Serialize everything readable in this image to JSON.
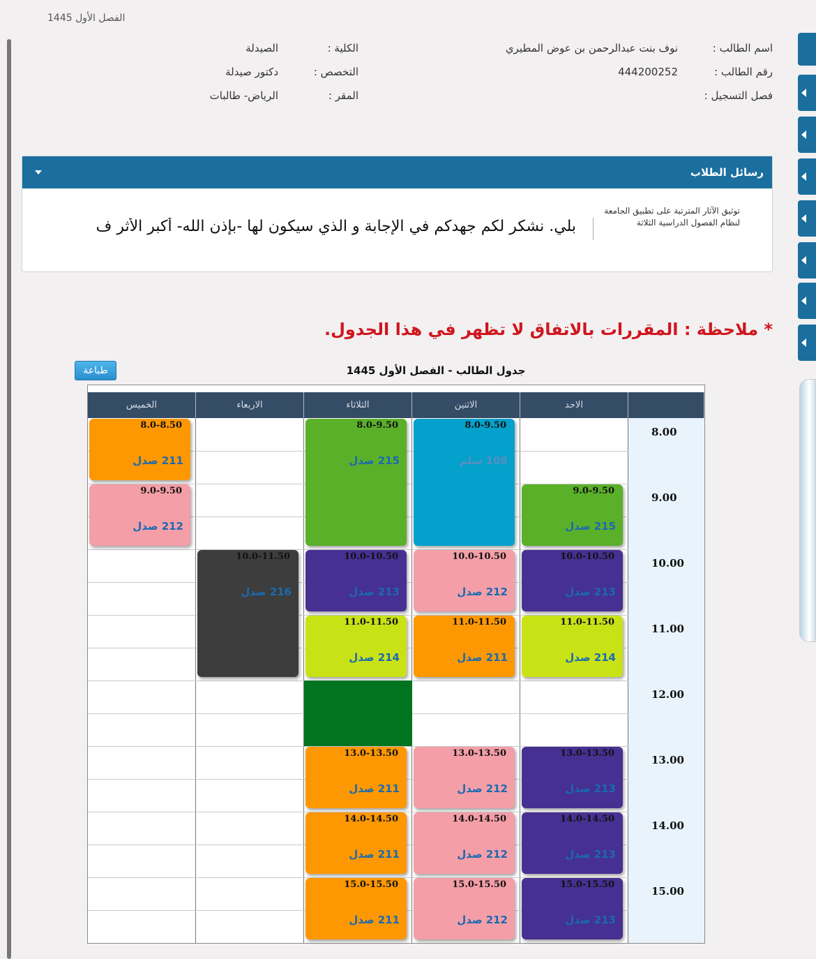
{
  "top_semester": "الفصل الأول 1445",
  "student": {
    "name_label": "اسم الطالب :",
    "name_value": "نوف بنت عبدالرحمن بن عوض المطيري",
    "id_label": "رقم الطالب :",
    "id_value": "444200252",
    "reg_label": "فصل التسجيل :",
    "college_label": "الكلية :",
    "college_value": "الصيدلة",
    "major_label": "التخصص :",
    "major_value": "دكتور صيدلة",
    "campus_label": "المقر :",
    "campus_value": "الرياض- طالبات"
  },
  "messages": {
    "title": "رسائل الطلاب",
    "item_title": "توثيق الآثار المترتبة على تطبيق الجامعة لنظام الفصول الدراسية الثلاثة",
    "item_text": "بلي. نشكر لكم جهدكم في الإجابة و الذي سيكون لها -بإذن الله- أكبر الأثر ف"
  },
  "note": "* ملاحظة : المقررات بالاتفاق لا تظهر في هذا الجدول.",
  "print_label": "طباعة",
  "schedule": {
    "title": "جدول الطالب  - الفصل الأول 1445",
    "days": [
      "الاحد",
      "الاثنين",
      "الثلاثاء",
      "الاربعاء",
      "الخميس"
    ],
    "times": [
      "8.00",
      "9.00",
      "10.00",
      "11.00",
      "12.00",
      "13.00",
      "14.00",
      "15.00"
    ],
    "blocks": [
      {
        "day": 0,
        "start": 9,
        "end": 10,
        "time": "9.0-9.50",
        "room": "215 صدل",
        "color": "green"
      },
      {
        "day": 0,
        "start": 10,
        "end": 11,
        "time": "10.0-10.50",
        "room": "213 صدل",
        "color": "purple"
      },
      {
        "day": 0,
        "start": 11,
        "end": 12,
        "time": "11.0-11.50",
        "room": "214 صدل",
        "color": "lime"
      },
      {
        "day": 0,
        "start": 13,
        "end": 14,
        "time": "13.0-13.50",
        "room": "213 صدل",
        "color": "purple"
      },
      {
        "day": 0,
        "start": 14,
        "end": 15,
        "time": "14.0-14.50",
        "room": "213 صدل",
        "color": "purple"
      },
      {
        "day": 0,
        "start": 15,
        "end": 16,
        "time": "15.0-15.50",
        "room": "213 صدل",
        "color": "purple"
      },
      {
        "day": 1,
        "start": 8,
        "end": 10,
        "time": "8.0-9.50",
        "room": "108 سلم",
        "color": "cyan"
      },
      {
        "day": 1,
        "start": 10,
        "end": 11,
        "time": "10.0-10.50",
        "room": "212 صدل",
        "color": "pink"
      },
      {
        "day": 1,
        "start": 11,
        "end": 12,
        "time": "11.0-11.50",
        "room": "211 صدل",
        "color": "orange"
      },
      {
        "day": 1,
        "start": 13,
        "end": 14,
        "time": "13.0-13.50",
        "room": "212 صدل",
        "color": "pink"
      },
      {
        "day": 1,
        "start": 14,
        "end": 15,
        "time": "14.0-14.50",
        "room": "212 صدل",
        "color": "pink"
      },
      {
        "day": 1,
        "start": 15,
        "end": 16,
        "time": "15.0-15.50",
        "room": "212 صدل",
        "color": "pink"
      },
      {
        "day": 2,
        "start": 8,
        "end": 10,
        "time": "8.0-9.50",
        "room": "215 صدل",
        "color": "green"
      },
      {
        "day": 2,
        "start": 10,
        "end": 11,
        "time": "10.0-10.50",
        "room": "213 صدل",
        "color": "purple"
      },
      {
        "day": 2,
        "start": 11,
        "end": 12,
        "time": "11.0-11.50",
        "room": "214 صدل",
        "color": "lime"
      },
      {
        "day": 2,
        "start": 12,
        "end": 13,
        "time": "",
        "room": "",
        "color": "dgreen"
      },
      {
        "day": 2,
        "start": 13,
        "end": 14,
        "time": "13.0-13.50",
        "room": "211 صدل",
        "color": "orange"
      },
      {
        "day": 2,
        "start": 14,
        "end": 15,
        "time": "14.0-14.50",
        "room": "211 صدل",
        "color": "orange"
      },
      {
        "day": 2,
        "start": 15,
        "end": 16,
        "time": "15.0-15.50",
        "room": "211 صدل",
        "color": "orange"
      },
      {
        "day": 3,
        "start": 10,
        "end": 12,
        "time": "10.0-11.50",
        "room": "216 صدل",
        "color": "dark"
      },
      {
        "day": 4,
        "start": 8,
        "end": 9,
        "time": "8.0-8.50",
        "room": "211 صدل",
        "color": "orange"
      },
      {
        "day": 4,
        "start": 9,
        "end": 10,
        "time": "9.0-9.50",
        "room": "212 صدل",
        "color": "pink"
      }
    ]
  }
}
